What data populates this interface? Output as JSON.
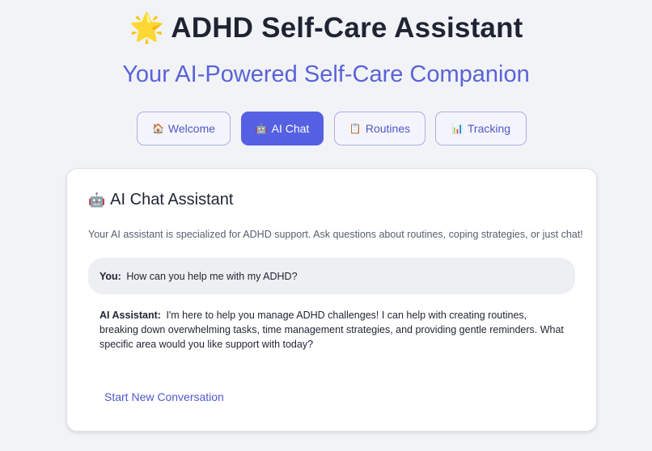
{
  "header": {
    "icon": "glowing-star",
    "icon_glyph": "🌟",
    "title": "ADHD Self-Care Assistant",
    "subtitle": "Your AI-Powered Self-Care Companion"
  },
  "tabs": [
    {
      "icon": "house",
      "icon_glyph": "🏠",
      "label": "Welcome",
      "active": false
    },
    {
      "icon": "robot",
      "icon_glyph": "🤖",
      "label": "AI Chat",
      "active": true
    },
    {
      "icon": "clipboard",
      "icon_glyph": "📋",
      "label": "Routines",
      "active": false
    },
    {
      "icon": "bar-chart",
      "icon_glyph": "📊",
      "label": "Tracking",
      "active": false
    }
  ],
  "chat": {
    "title_icon": "robot",
    "title_icon_glyph": "🤖",
    "title": "AI Chat Assistant",
    "description": "Your AI assistant is specialized for ADHD support. Ask questions about routines, coping strategies, or just chat!",
    "messages": [
      {
        "sender": "You:",
        "text": "How can you help me with my ADHD?"
      },
      {
        "sender": "AI Assistant:",
        "text": "I'm here to help you manage ADHD challenges! I can help with creating routines, breaking down overwhelming tasks, time management strategies, and providing gentle reminders. What specific area would you like support with today?"
      }
    ],
    "new_conversation_label": "Start New Conversation"
  },
  "colors": {
    "accent": "#5560e3",
    "subtitle": "#5a63d6",
    "background": "#f1f3f7",
    "user_bubble": "#eeeff2"
  }
}
